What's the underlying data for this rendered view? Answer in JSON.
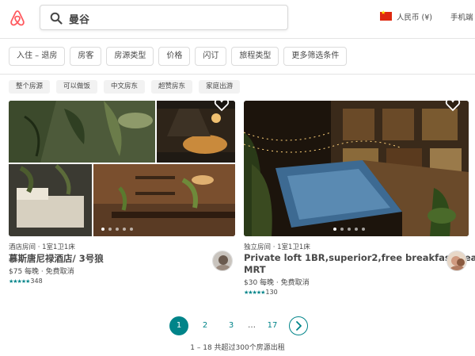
{
  "header": {
    "search_value": "曼谷",
    "currency_label": "人民币 (¥)",
    "mobile_label": "手机端"
  },
  "filters": [
    "入住 – 退房",
    "房客",
    "房源类型",
    "价格",
    "闪订",
    "旅程类型",
    "更多筛选条件"
  ],
  "tags": [
    "整个房源",
    "可以做饭",
    "中文房东",
    "超赞房东",
    "家庭出游"
  ],
  "listings": [
    {
      "meta": "酒店房间 · 1室1卫1床",
      "title": "慕斯唐尼禄酒店/ 3号狼",
      "price": "$75 每晚 · 免费取消",
      "stars": "★★★★★",
      "reviews": "348"
    },
    {
      "meta": "独立房间 · 1室1卫1床",
      "title_line1": "Private loft 1BR,superior2,free breakfast,near",
      "title_line2": "MRT",
      "price": "$30 每晚 · 免费取消",
      "stars": "★★★★★",
      "reviews": "130"
    }
  ],
  "pagination": {
    "pages": [
      "1",
      "2",
      "3",
      "…",
      "17"
    ],
    "current": "1",
    "summary": "1 – 18 共超过300个房源出租"
  },
  "colors": {
    "brand": "#FF5A5F",
    "accent": "#008489",
    "text": "#484848"
  },
  "icons": [
    "airbnb-logo-icon",
    "search-icon",
    "china-flag-icon",
    "heart-icon",
    "chevron-right-icon"
  ]
}
